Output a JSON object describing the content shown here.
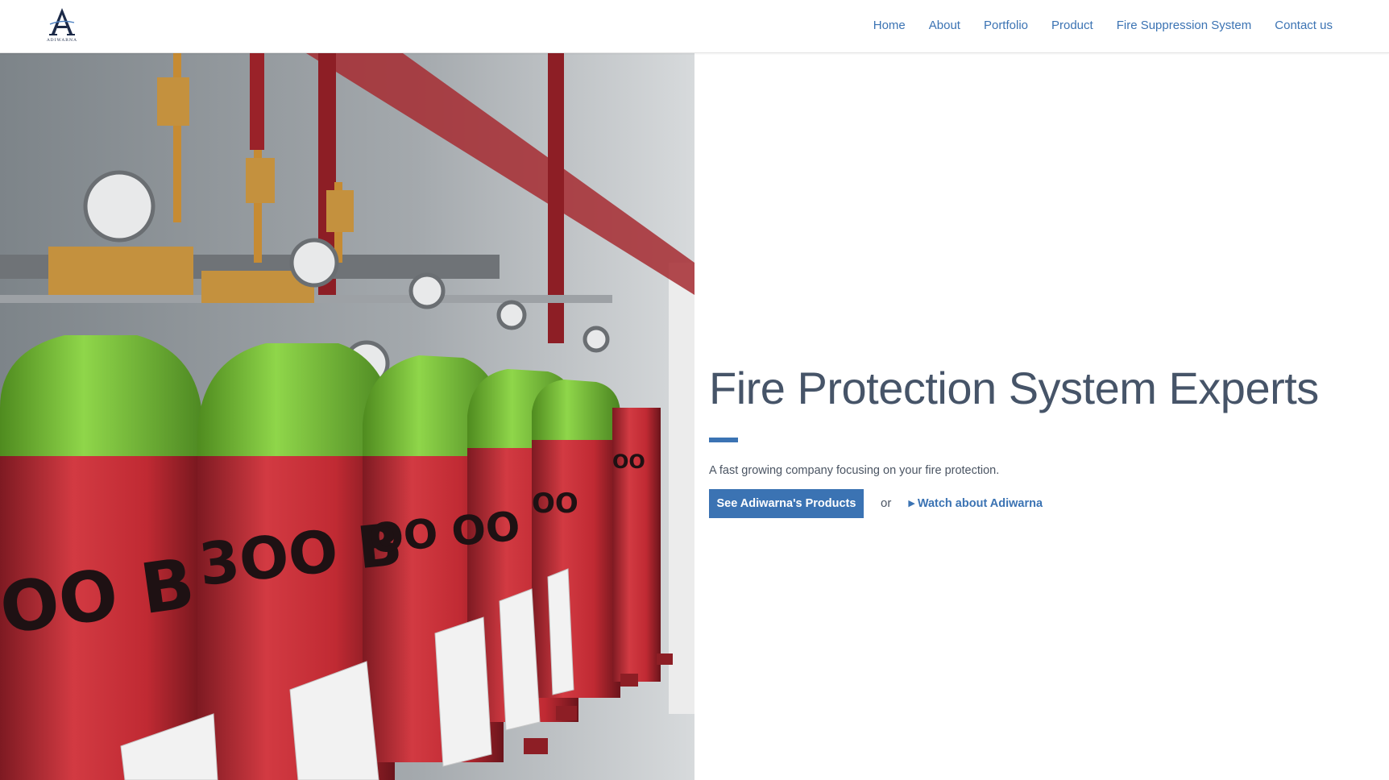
{
  "brand": {
    "logo_letter": "A",
    "logo_text": "ADIWARNA"
  },
  "nav": {
    "items": [
      {
        "label": "Home"
      },
      {
        "label": "About"
      },
      {
        "label": "Portfolio"
      },
      {
        "label": "Product"
      },
      {
        "label": "Fire Suppression System"
      },
      {
        "label": "Contact us"
      }
    ]
  },
  "hero": {
    "image_description_icon": "gas-cylinder-photo",
    "title": "Fire Protection System Experts",
    "subtitle": "A fast growing company focusing on your fire protection.",
    "cta_primary": "See Adiwarna's Products",
    "cta_separator": "or",
    "cta_secondary": "Watch about Adiwarna",
    "cylinder_label": "INERGEN"
  },
  "colors": {
    "accent": "#3b73b3",
    "title": "#465468",
    "text": "#4b5563",
    "cylinder_red": "#c8303a",
    "cylinder_green": "#7cc23a"
  }
}
